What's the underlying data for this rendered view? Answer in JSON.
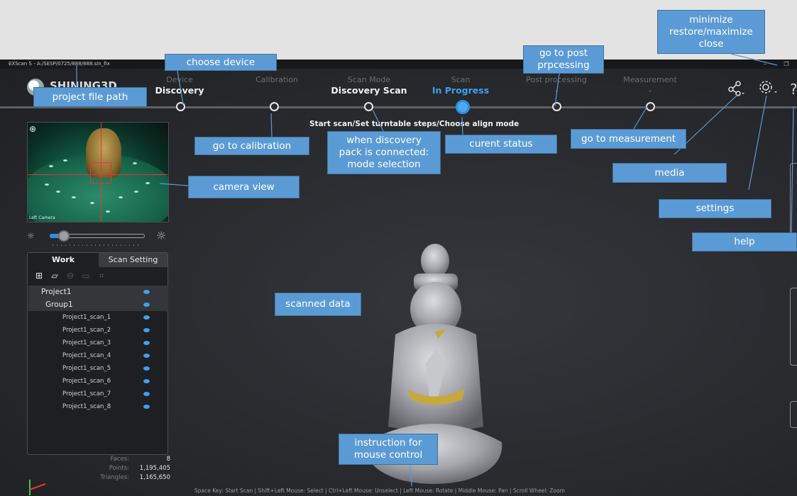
{
  "window": {
    "title_path": "EXScan S  - A:/SESP/0725/888/888.sln_fix",
    "minimize_glyph": "–",
    "restore_glyph": "❐"
  },
  "brand": {
    "logo_text": "SHINING3D"
  },
  "workflow": {
    "steps": [
      {
        "label": "Device",
        "value": "Discovery",
        "state": "done"
      },
      {
        "label": "Calibration",
        "value": "",
        "state": "pending"
      },
      {
        "label": "Scan Mode",
        "value": "Discovery Scan",
        "state": "done"
      },
      {
        "label": "Scan",
        "value": "In Progress",
        "state": "active"
      },
      {
        "label": "Post processing",
        "value": "-",
        "state": "pending"
      },
      {
        "label": "Measurement",
        "value": "-",
        "state": "pending"
      }
    ],
    "instruction": "Start scan/Set turntable steps/Choose align mode"
  },
  "toolbar_icons": {
    "media": "share-icon",
    "settings": "gear-icon",
    "help": "help-icon"
  },
  "camera": {
    "label": "Left Camera",
    "brightness": 0.12
  },
  "panel": {
    "tabs": [
      "Work",
      "Scan Setting"
    ],
    "tree": {
      "project": "Project1",
      "group": "Group1",
      "scans": [
        "Project1_scan_1",
        "Project1_scan_2",
        "Project1_scan_3",
        "Project1_scan_4",
        "Project1_scan_5",
        "Project1_scan_6",
        "Project1_scan_7",
        "Project1_scan_8"
      ]
    }
  },
  "stats": [
    {
      "key": "Faces:",
      "value": "8"
    },
    {
      "key": "Points:",
      "value": "1,195,405"
    },
    {
      "key": "Triangles:",
      "value": "1,165,650"
    }
  ],
  "mouse_help": "Space Key: Start Scan | Shift+Left Mouse: Select | Ctrl+Left Mouse: Unselect | Left Mouse: Rotate | Middle Mouse: Pan | Scroll Wheel: Zoom",
  "annotations": {
    "choose_device": "choose device",
    "project_file_path": "project file path",
    "go_to_post_processing": [
      "go to post",
      "prpcessing"
    ],
    "window_controls": [
      "minimize",
      "restore/maximize",
      "close"
    ],
    "go_to_calibration": "go to calibration",
    "mode_selection": [
      "when discovery",
      "pack is connected:",
      "mode selection"
    ],
    "current_status": "curent status",
    "go_to_measurement": "go to measurement",
    "media": "media",
    "settings": "settings",
    "help": "help",
    "camera_view": "camera view",
    "scanned_data": "scanned data",
    "mouse_control": [
      "instruction for",
      "mouse control"
    ]
  }
}
